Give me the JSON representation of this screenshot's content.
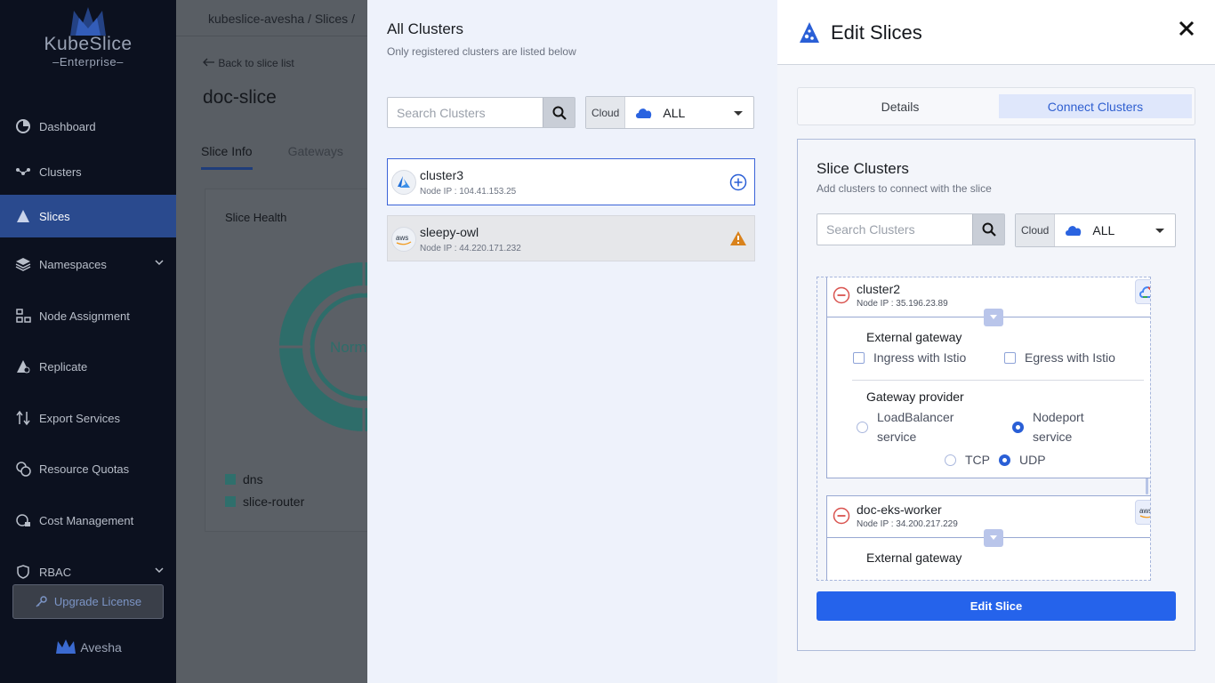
{
  "sidebar": {
    "brand_title": "KubeSlice",
    "brand_sub": "Enterprise",
    "items": [
      {
        "label": "Dashboard",
        "icon": "pie-icon"
      },
      {
        "label": "Clusters",
        "icon": "network-icon"
      },
      {
        "label": "Slices",
        "icon": "slice-icon",
        "active": true
      },
      {
        "label": "Namespaces",
        "icon": "layers-icon"
      },
      {
        "label": "Node Assignment",
        "icon": "node-icon"
      },
      {
        "label": "Replicate",
        "icon": "replicate-icon"
      },
      {
        "label": "Export Services",
        "icon": "arrows-icon"
      },
      {
        "label": "Resource Quotas",
        "icon": "coins-icon"
      },
      {
        "label": "Cost Management",
        "icon": "cost-icon"
      },
      {
        "label": "RBAC",
        "icon": "shield-icon"
      }
    ],
    "upgrade_label": "Upgrade License",
    "footer_brand": "Avesha"
  },
  "main": {
    "breadcrumb": "kubeslice-avesha / Slices /",
    "back_label": "Back to slice list",
    "slice_name": "doc-slice",
    "tabs": [
      "Slice Info",
      "Gateways"
    ],
    "health_title": "Slice Health",
    "donut_label": "Norm",
    "legend": [
      "dns",
      "slice-router"
    ]
  },
  "all_clusters": {
    "title": "All Clusters",
    "subtitle": "Only registered clusters are listed below",
    "search_placeholder": "Search Clusters",
    "cloud_label": "Cloud",
    "cloud_value": "ALL",
    "clusters": [
      {
        "name": "cluster3",
        "ip": "Node IP : 104.41.153.25",
        "provider": "azure",
        "action": "add-icon"
      },
      {
        "name": "sleepy-owl",
        "ip": "Node IP : 44.220.171.232",
        "provider": "aws",
        "action": "warning-icon"
      }
    ]
  },
  "drawer": {
    "title": "Edit Slices",
    "tabs": {
      "details": "Details",
      "connect": "Connect Clusters"
    },
    "section_title": "Slice Clusters",
    "section_sub": "Add clusters to connect with the slice",
    "search_placeholder": "Search Clusters",
    "cloud_label": "Cloud",
    "cloud_value": "ALL",
    "selected_clusters": [
      {
        "name": "cluster2",
        "ip": "Node IP : 35.196.23.89",
        "provider": "gcp",
        "external_gateway_label": "External gateway",
        "ingress_label": "Ingress with Istio",
        "egress_label": "Egress with Istio",
        "gateway_provider_label": "Gateway provider",
        "lb_label": "LoadBalancer service",
        "nodeport_label": "Nodeport service",
        "tcp_label": "TCP",
        "udp_label": "UDP"
      },
      {
        "name": "doc-eks-worker",
        "ip": "Node IP : 34.200.217.229",
        "provider": "aws",
        "external_gateway_label": "External gateway"
      }
    ],
    "submit_label": "Edit Slice"
  },
  "colors": {
    "accent": "#2563eb",
    "sidebar_bg": "#0c111f",
    "active_nav": "#2a4a8e",
    "warning": "#d9821c"
  }
}
